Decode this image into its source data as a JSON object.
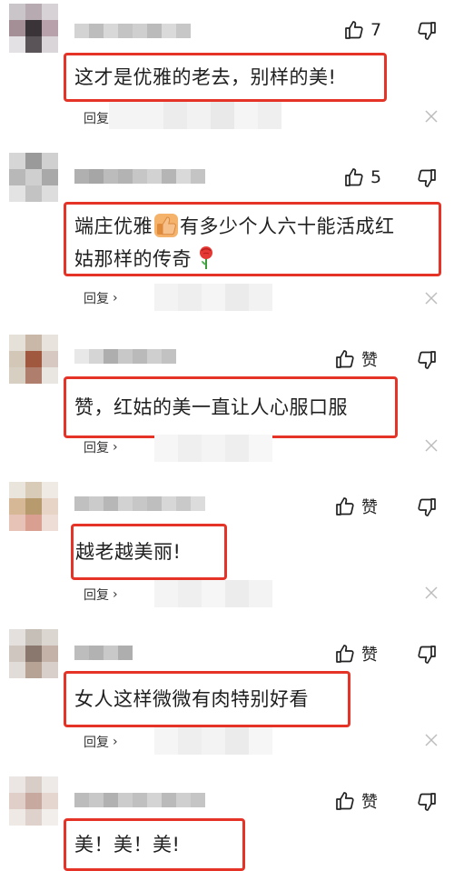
{
  "comments": [
    {
      "text": "这才是优雅的老去，别样的美!",
      "like_label": "7",
      "reply_label": "回复",
      "emoji": ""
    },
    {
      "text_a": "端庄优雅",
      "text_b": "有多少个人六十能活成红",
      "text_c": "姑那样的传奇",
      "like_label": "5",
      "reply_label": "回复"
    },
    {
      "text": "赞，红姑的美一直让人心服口服",
      "like_label": "赞",
      "reply_label": "回复"
    },
    {
      "text": "越老越美丽!",
      "like_label": "赞",
      "reply_label": "回复"
    },
    {
      "text": "女人这样微微有肉特别好看",
      "like_label": "赞",
      "reply_label": "回复"
    },
    {
      "text": "美！美！美!",
      "like_label": "赞",
      "reply_label": "回复"
    }
  ],
  "icons": {
    "like": "thumbs-up-icon",
    "dislike": "thumbs-down-icon",
    "close": "close-icon",
    "chevron": "chevron-right-icon"
  },
  "colors": {
    "highlight_border": "#e53327"
  }
}
